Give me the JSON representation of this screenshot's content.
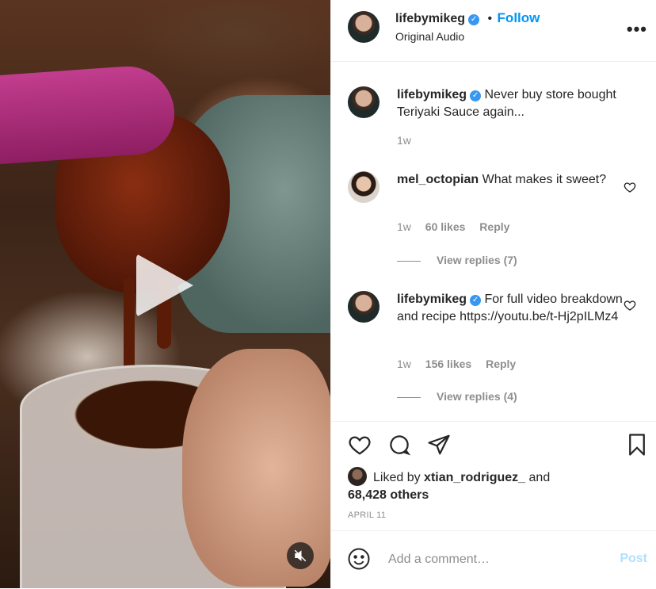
{
  "post": {
    "author": "lifebymikeg",
    "follow_label": "Follow",
    "dot": "•",
    "audio": "Original Audio",
    "more": "•••"
  },
  "comments": [
    {
      "user": "lifebymikeg",
      "verified": true,
      "text": "Never buy store bought Teriyaki Sauce again...",
      "time": "1w"
    },
    {
      "user": "mel_octopian",
      "verified": false,
      "text": "What makes it sweet?",
      "time": "1w",
      "likes": "60 likes",
      "reply": "Reply",
      "view_replies": "View replies (7)"
    },
    {
      "user": "lifebymikeg",
      "verified": true,
      "text": "For full video breakdown and recipe https://youtu.be/t-Hj2pILMz4",
      "time": "1w",
      "likes": "156 likes",
      "reply": "Reply",
      "view_replies": "View replies (4)"
    }
  ],
  "likes": {
    "prefix": "Liked by",
    "user": "xtian_rodriguez_",
    "conj": "and",
    "others": "68,428 others"
  },
  "date": "APRIL 11",
  "add_comment": {
    "placeholder": "Add a comment…",
    "post_label": "Post"
  },
  "icons": {
    "play": "play-icon",
    "mute": "muted-speaker-icon",
    "like": "heart-icon",
    "comment": "comment-bubble-icon",
    "share": "paper-plane-icon",
    "save": "bookmark-icon",
    "emoji": "smiley-icon"
  },
  "colors": {
    "follow": "#0095f6",
    "verified": "#3897f0",
    "post_disabled": "#b2dffc",
    "muted_text": "#8e8e8e"
  }
}
